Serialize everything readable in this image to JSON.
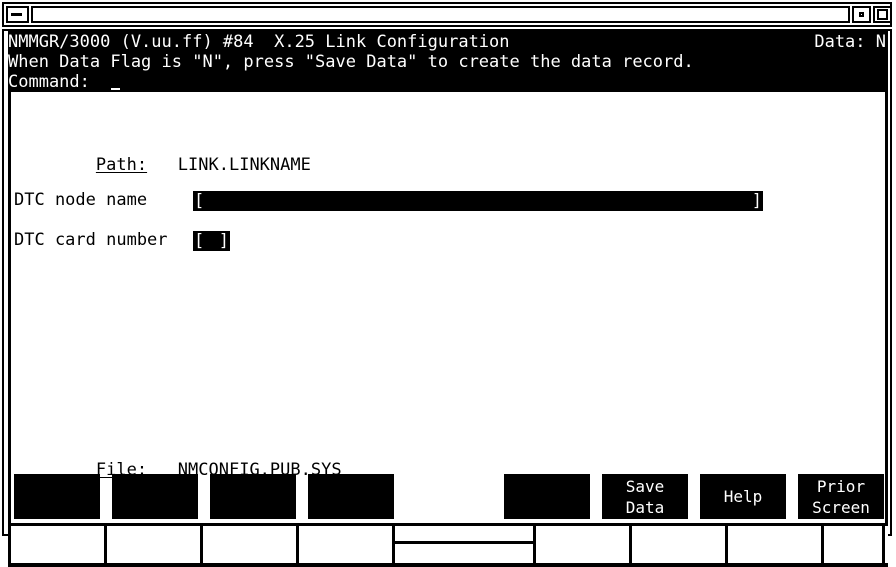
{
  "window": {
    "title_field_text": "",
    "buttons": {
      "minimize": "minimize",
      "restore": "restore",
      "maximize": "maximize"
    }
  },
  "header": {
    "line1_left": "NMMGR/3000 (V.uu.ff) #84  X.25 Link Configuration",
    "line1_right": "Data: N",
    "line2": "When Data Flag is \"N\", press \"Save Data\" to create the data record.",
    "line3": "Command:",
    "command_value": ""
  },
  "body": {
    "path_label": "Path:",
    "path_value": "LINK.LINKNAME",
    "file_label": "File:",
    "file_value": "NMCONFIG.PUB.SYS",
    "fields": [
      {
        "label": "DTC node name",
        "value": "",
        "open_bracket": "[",
        "close_bracket": "]"
      },
      {
        "label": "DTC card number",
        "value": "",
        "open_bracket": "[",
        "close_bracket": "]"
      }
    ]
  },
  "function_keys": [
    {
      "label": "",
      "blank": false
    },
    {
      "label": "",
      "blank": false
    },
    {
      "label": "",
      "blank": false
    },
    {
      "label": "",
      "blank": false
    },
    {
      "label": "",
      "blank": true
    },
    {
      "label": "",
      "blank": false
    },
    {
      "label": "Save\nData",
      "blank": false
    },
    {
      "label": "Help",
      "blank": false
    },
    {
      "label": "Prior\nScreen",
      "blank": false
    }
  ],
  "colors": {
    "foreground": "#000000",
    "background": "#ffffff",
    "inverse_text": "#ffffff",
    "inverse_bg": "#000000"
  }
}
